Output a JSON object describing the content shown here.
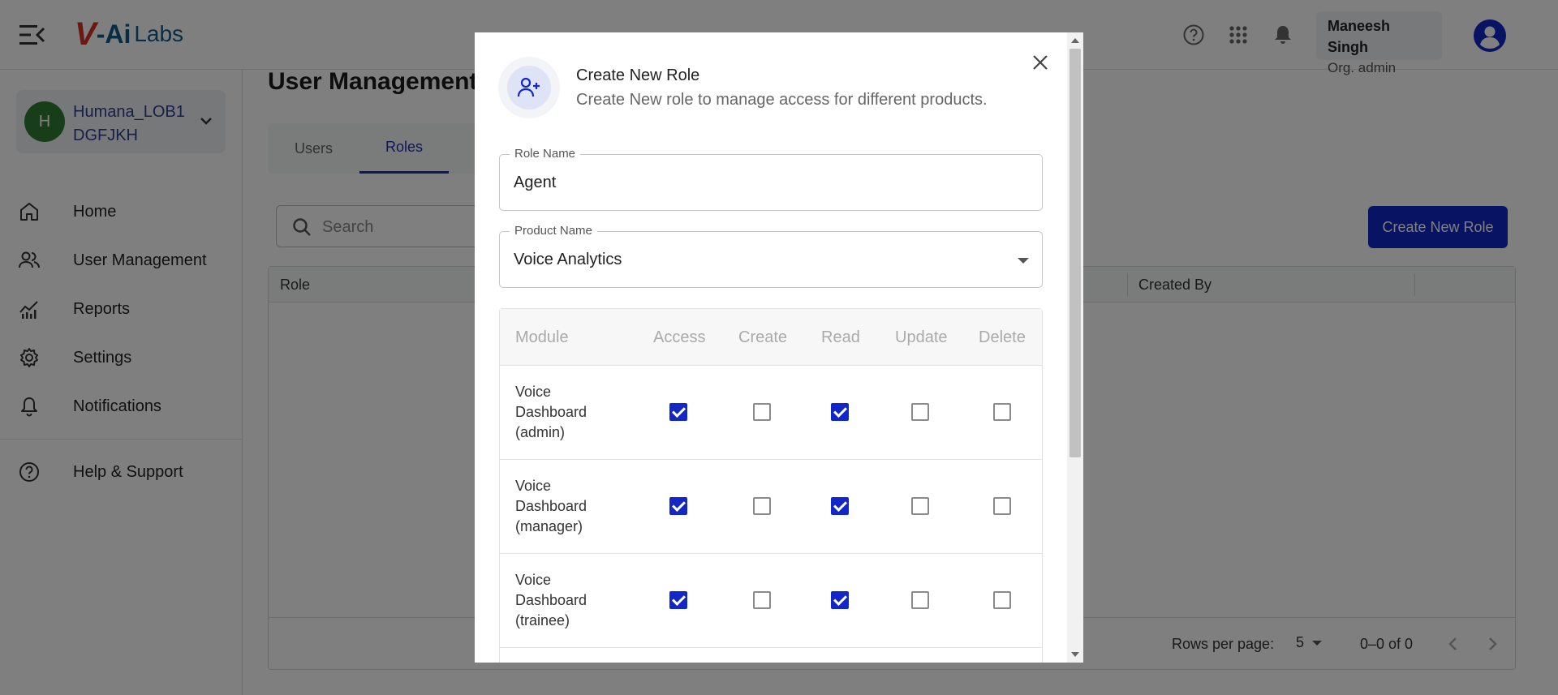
{
  "app": {
    "logo_v": "V",
    "logo_ai": "-Ai",
    "logo_labs": "Labs"
  },
  "header": {
    "user_name": "Maneesh Singh",
    "user_role": "Org. admin",
    "icons": [
      "help-icon",
      "apps-grid-icon",
      "bell-icon",
      "account-icon"
    ]
  },
  "sidebar": {
    "org": {
      "initial": "H",
      "name": "Humana_LOB1",
      "code": "DGFJKH"
    },
    "items": [
      {
        "label": "Home",
        "icon": "home-icon"
      },
      {
        "label": "User Management",
        "icon": "users-icon"
      },
      {
        "label": "Reports",
        "icon": "reports-icon"
      },
      {
        "label": "Settings",
        "icon": "gear-icon"
      },
      {
        "label": "Notifications",
        "icon": "bell-icon"
      },
      {
        "label": "Help & Support",
        "icon": "help-icon"
      }
    ]
  },
  "main": {
    "title": "User Management",
    "tabs": [
      {
        "label": "Users",
        "active": false
      },
      {
        "label": "Roles",
        "active": true
      }
    ],
    "search": {
      "placeholder": "Search"
    },
    "create_button": "Create New Role",
    "table": {
      "columns": [
        "Role",
        "Created By"
      ]
    },
    "pagination": {
      "rows_per_page_label": "Rows per page:",
      "rows_per_page": "5",
      "range": "0–0 of 0"
    }
  },
  "modal": {
    "title": "Create New Role",
    "subtitle": "Create New role to manage access for different products.",
    "role_name": {
      "label": "Role Name",
      "value": "Agent"
    },
    "product_name": {
      "label": "Product Name",
      "value": "Voice Analytics"
    },
    "permissions": {
      "columns": [
        "Module",
        "Access",
        "Create",
        "Read",
        "Update",
        "Delete"
      ],
      "rows": [
        {
          "module": [
            "Voice",
            "Dashboard",
            "(admin)"
          ],
          "access": true,
          "create": false,
          "read": true,
          "update": false,
          "delete": false
        },
        {
          "module": [
            "Voice",
            "Dashboard",
            "(manager)"
          ],
          "access": true,
          "create": false,
          "read": true,
          "update": false,
          "delete": false
        },
        {
          "module": [
            "Voice",
            "Dashboard",
            "(trainee)"
          ],
          "access": true,
          "create": false,
          "read": true,
          "update": false,
          "delete": false
        }
      ]
    }
  },
  "colors": {
    "primary": "#1327c9",
    "org_avatar": "#2e7d32",
    "org_text": "#2c3e91"
  }
}
